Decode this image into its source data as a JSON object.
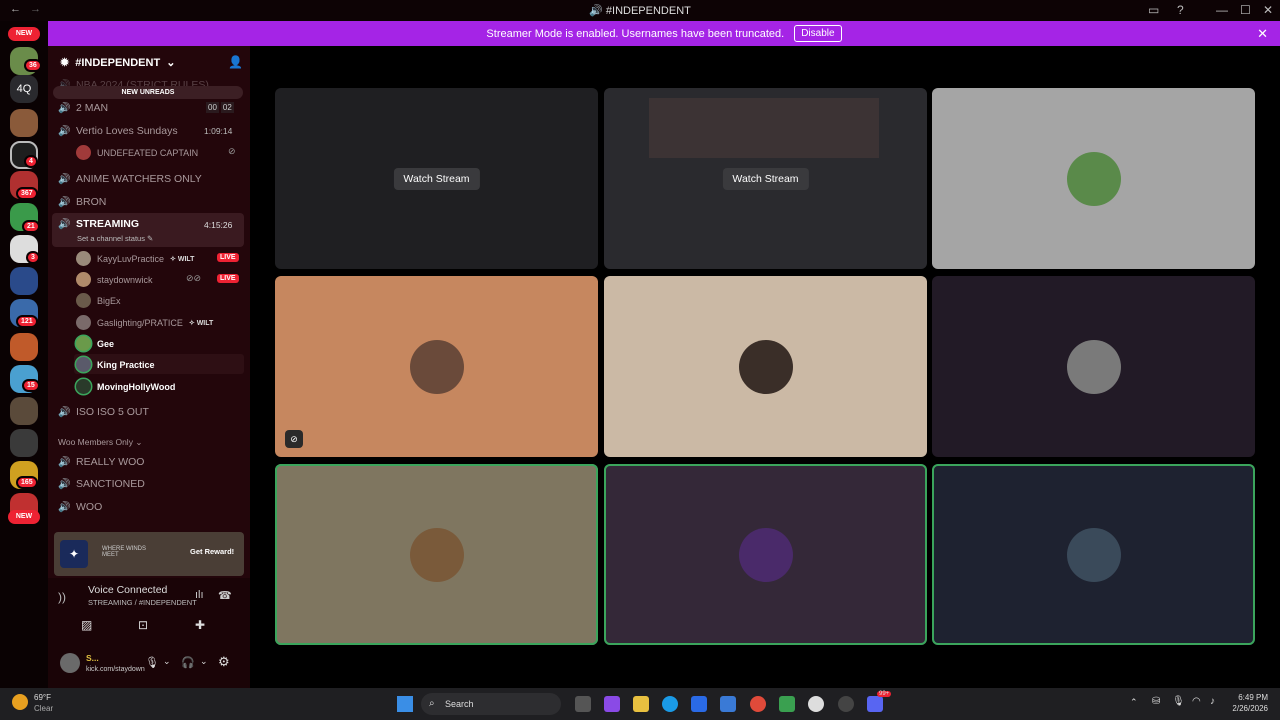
{
  "window": {
    "title": "#INDEPENDENT",
    "back": "←",
    "forward": "→"
  },
  "banner": {
    "text": "Streamer Mode is enabled. Usernames have been truncated.",
    "disable": "Disable"
  },
  "guilds": {
    "new_top": "NEW",
    "new_bottom": "NEW",
    "text_guild": "4Q",
    "badges": [
      "36",
      "4",
      "367",
      "21",
      "3",
      "121",
      "15",
      "165"
    ]
  },
  "server": {
    "name": "#INDEPENDENT",
    "new_unreads": "NEW UNREADS",
    "partial_channel": "NBA 2024 (STRICT RULES)"
  },
  "channels": [
    {
      "name": "2 MAN",
      "timer_a": "00",
      "timer_b": "02"
    },
    {
      "name": "Vertio Loves Sundays",
      "timer": "1:09:14",
      "member": "UNDEFEATED CAPTAIN"
    },
    {
      "name": "ANIME WATCHERS ONLY"
    },
    {
      "name": "BRON"
    },
    {
      "name": "STREAMING",
      "timer": "4:15:26",
      "status": "Set a channel status"
    },
    {
      "name": "ISO ISO 5 OUT"
    }
  ],
  "streaming_members": [
    {
      "name": "KayyLuvPractice",
      "tag": "WILT",
      "live": "LIVE"
    },
    {
      "name": "staydownwick",
      "live": "LIVE"
    },
    {
      "name": "BigEx"
    },
    {
      "name": "Gaslighting/PRATICE",
      "tag": "WILT"
    },
    {
      "name": "Gee"
    },
    {
      "name": "King Practice"
    },
    {
      "name": "MovingHollyWood"
    }
  ],
  "category": {
    "name": "Woo Members Only",
    "channels": [
      "REALLY WOO",
      "SANCTIONED",
      "WOO"
    ]
  },
  "promo": {
    "brand": "WHERE WINDS MEET",
    "button": "Get Reward!"
  },
  "voice": {
    "status": "Voice Connected",
    "location": "STREAMING / #INDEPENDENT"
  },
  "user": {
    "name": "S...",
    "activity": "kick.com/staydown"
  },
  "tiles": [
    {
      "watch": "Watch Stream",
      "bg": "#1f1f22"
    },
    {
      "watch": "Watch Stream",
      "bg": "#2a2a2e"
    },
    {
      "bg": "#a5a5a5"
    },
    {
      "bg": "#c6875f"
    },
    {
      "bg": "#cbb9a5"
    },
    {
      "bg": "#221a26"
    },
    {
      "bg": "#7f7660",
      "speaking": true
    },
    {
      "bg": "#342838",
      "speaking": true
    },
    {
      "bg": "#1e2230",
      "speaking": true
    }
  ],
  "taskbar": {
    "weather_temp": "69°F",
    "weather_cond": "Clear",
    "search": "Search",
    "time": "6:49 PM",
    "date": "2/26/2026",
    "notif": "99+"
  },
  "colors": {
    "accent": "#a524e6",
    "live": "#e22233",
    "speaking": "#3ba55c"
  }
}
